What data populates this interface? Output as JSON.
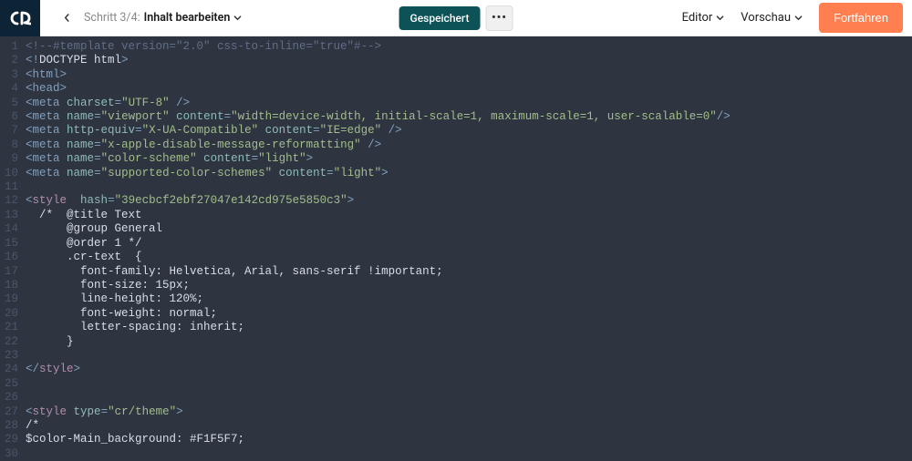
{
  "topbar": {
    "step_prefix": "Schritt 3/4:",
    "step_title": "Inhalt bearbeiten",
    "saved_label": "Gespeichert",
    "more_label": "•••",
    "editor_link": "Editor",
    "preview_link": "Vorschau",
    "continue_label": "Fortfahren"
  },
  "code_lines": [
    {
      "n": 1,
      "segs": [
        {
          "t": "<!--#template version=\"2.0\" css-to-inline=\"true\"#-->",
          "c": "c-comment"
        }
      ]
    },
    {
      "n": 2,
      "segs": [
        {
          "t": "<!",
          "c": "c-bracket"
        },
        {
          "t": "DOCTYPE html",
          "c": "c-doctype"
        },
        {
          "t": ">",
          "c": "c-bracket"
        }
      ]
    },
    {
      "n": 3,
      "segs": [
        {
          "t": "<",
          "c": "c-bracket"
        },
        {
          "t": "html",
          "c": "c-tag"
        },
        {
          "t": ">",
          "c": "c-bracket"
        }
      ]
    },
    {
      "n": 4,
      "segs": [
        {
          "t": "<",
          "c": "c-bracket"
        },
        {
          "t": "head",
          "c": "c-tag"
        },
        {
          "t": ">",
          "c": "c-bracket"
        }
      ]
    },
    {
      "n": 5,
      "segs": [
        {
          "t": "<",
          "c": "c-bracket"
        },
        {
          "t": "meta",
          "c": "c-tag"
        },
        {
          "t": " ",
          "c": "c-text"
        },
        {
          "t": "charset",
          "c": "c-attr"
        },
        {
          "t": "=",
          "c": "c-bracket"
        },
        {
          "t": "\"UTF-8\"",
          "c": "c-val"
        },
        {
          "t": " />",
          "c": "c-bracket"
        }
      ]
    },
    {
      "n": 6,
      "segs": [
        {
          "t": "<",
          "c": "c-bracket"
        },
        {
          "t": "meta",
          "c": "c-tag"
        },
        {
          "t": " ",
          "c": "c-text"
        },
        {
          "t": "name",
          "c": "c-attr"
        },
        {
          "t": "=",
          "c": "c-bracket"
        },
        {
          "t": "\"viewport\"",
          "c": "c-val"
        },
        {
          "t": " ",
          "c": "c-text"
        },
        {
          "t": "content",
          "c": "c-attr"
        },
        {
          "t": "=",
          "c": "c-bracket"
        },
        {
          "t": "\"width=device-width, initial-scale=1, maximum-scale=1, user-scalable=0\"",
          "c": "c-val"
        },
        {
          "t": "/>",
          "c": "c-bracket"
        }
      ]
    },
    {
      "n": 7,
      "segs": [
        {
          "t": "<",
          "c": "c-bracket"
        },
        {
          "t": "meta",
          "c": "c-tag"
        },
        {
          "t": " ",
          "c": "c-text"
        },
        {
          "t": "http-equiv",
          "c": "c-attr"
        },
        {
          "t": "=",
          "c": "c-bracket"
        },
        {
          "t": "\"X-UA-Compatible\"",
          "c": "c-val"
        },
        {
          "t": " ",
          "c": "c-text"
        },
        {
          "t": "content",
          "c": "c-attr"
        },
        {
          "t": "=",
          "c": "c-bracket"
        },
        {
          "t": "\"IE=edge\"",
          "c": "c-val"
        },
        {
          "t": " />",
          "c": "c-bracket"
        }
      ]
    },
    {
      "n": 8,
      "segs": [
        {
          "t": "<",
          "c": "c-bracket"
        },
        {
          "t": "meta",
          "c": "c-tag"
        },
        {
          "t": " ",
          "c": "c-text"
        },
        {
          "t": "name",
          "c": "c-attr"
        },
        {
          "t": "=",
          "c": "c-bracket"
        },
        {
          "t": "\"x-apple-disable-message-reformatting\"",
          "c": "c-val"
        },
        {
          "t": " />",
          "c": "c-bracket"
        }
      ]
    },
    {
      "n": 9,
      "segs": [
        {
          "t": "<",
          "c": "c-bracket"
        },
        {
          "t": "meta",
          "c": "c-tag"
        },
        {
          "t": " ",
          "c": "c-text"
        },
        {
          "t": "name",
          "c": "c-attr"
        },
        {
          "t": "=",
          "c": "c-bracket"
        },
        {
          "t": "\"color-scheme\"",
          "c": "c-val"
        },
        {
          "t": " ",
          "c": "c-text"
        },
        {
          "t": "content",
          "c": "c-attr"
        },
        {
          "t": "=",
          "c": "c-bracket"
        },
        {
          "t": "\"light\"",
          "c": "c-val"
        },
        {
          "t": ">",
          "c": "c-bracket"
        }
      ]
    },
    {
      "n": 10,
      "segs": [
        {
          "t": "<",
          "c": "c-bracket"
        },
        {
          "t": "meta",
          "c": "c-tag"
        },
        {
          "t": " ",
          "c": "c-text"
        },
        {
          "t": "name",
          "c": "c-attr"
        },
        {
          "t": "=",
          "c": "c-bracket"
        },
        {
          "t": "\"supported-color-schemes\"",
          "c": "c-val"
        },
        {
          "t": " ",
          "c": "c-text"
        },
        {
          "t": "content",
          "c": "c-attr"
        },
        {
          "t": "=",
          "c": "c-bracket"
        },
        {
          "t": "\"light\"",
          "c": "c-val"
        },
        {
          "t": ">",
          "c": "c-bracket"
        }
      ]
    },
    {
      "n": 11,
      "segs": []
    },
    {
      "n": 12,
      "segs": [
        {
          "t": "<",
          "c": "c-bracket"
        },
        {
          "t": "style",
          "c": "c-style"
        },
        {
          "t": "  ",
          "c": "c-text"
        },
        {
          "t": "hash",
          "c": "c-attr"
        },
        {
          "t": "=",
          "c": "c-bracket"
        },
        {
          "t": "\"39ecbcf2ebf27047e142cd975e5850c3\"",
          "c": "c-val"
        },
        {
          "t": ">",
          "c": "c-bracket"
        }
      ]
    },
    {
      "n": 13,
      "segs": [
        {
          "t": "  /*  @title Text",
          "c": "c-cssprop"
        }
      ]
    },
    {
      "n": 14,
      "segs": [
        {
          "t": "      @group General",
          "c": "c-cssprop"
        }
      ]
    },
    {
      "n": 15,
      "segs": [
        {
          "t": "      @order 1 */",
          "c": "c-cssprop"
        }
      ]
    },
    {
      "n": 16,
      "segs": [
        {
          "t": "      .cr-text  {",
          "c": "c-cssprop"
        }
      ]
    },
    {
      "n": 17,
      "segs": [
        {
          "t": "        font-family: Helvetica, Arial, sans-serif !important;",
          "c": "c-cssprop"
        }
      ]
    },
    {
      "n": 18,
      "segs": [
        {
          "t": "        font-size: 15px;",
          "c": "c-cssprop"
        }
      ]
    },
    {
      "n": 19,
      "segs": [
        {
          "t": "        line-height: 120%;",
          "c": "c-cssprop"
        }
      ]
    },
    {
      "n": 20,
      "segs": [
        {
          "t": "        font-weight: normal;",
          "c": "c-cssprop"
        }
      ]
    },
    {
      "n": 21,
      "segs": [
        {
          "t": "        letter-spacing: inherit;",
          "c": "c-cssprop"
        }
      ]
    },
    {
      "n": 22,
      "segs": [
        {
          "t": "      }",
          "c": "c-cssprop"
        }
      ]
    },
    {
      "n": 23,
      "segs": []
    },
    {
      "n": 24,
      "segs": [
        {
          "t": "</",
          "c": "c-bracket"
        },
        {
          "t": "style",
          "c": "c-style"
        },
        {
          "t": ">",
          "c": "c-bracket"
        }
      ]
    },
    {
      "n": 25,
      "segs": []
    },
    {
      "n": 26,
      "segs": []
    },
    {
      "n": 27,
      "segs": [
        {
          "t": "<",
          "c": "c-bracket"
        },
        {
          "t": "style",
          "c": "c-style"
        },
        {
          "t": " ",
          "c": "c-text"
        },
        {
          "t": "type",
          "c": "c-attr"
        },
        {
          "t": "=",
          "c": "c-bracket"
        },
        {
          "t": "\"cr/theme\"",
          "c": "c-val"
        },
        {
          "t": ">",
          "c": "c-bracket"
        }
      ]
    },
    {
      "n": 28,
      "segs": [
        {
          "t": "/*",
          "c": "c-cssprop"
        }
      ]
    },
    {
      "n": 29,
      "segs": [
        {
          "t": "$color-Main_background: #F1F5F7;",
          "c": "c-cssprop"
        }
      ]
    },
    {
      "n": 30,
      "segs": [
        {
          "t": "",
          "c": "c-cssprop"
        }
      ]
    }
  ]
}
